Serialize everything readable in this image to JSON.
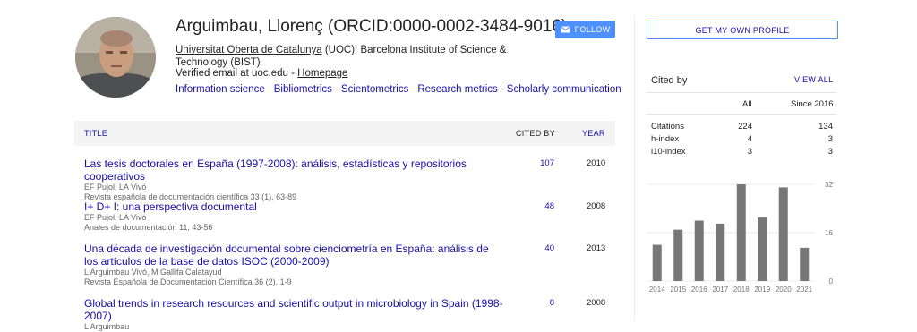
{
  "profile": {
    "name": "Arguimbau, Llorenç (ORCID:0000-0002-3484-9016)",
    "affiliation_link": "Universitat Oberta de Catalunya",
    "affiliation_rest": " (UOC); Barcelona Institute of Science & Technology (BIST)",
    "email_text": "Verified email at uoc.edu - ",
    "homepage_label": "Homepage",
    "interests": [
      "Information science",
      "Bibliometrics",
      "Scientometrics",
      "Research metrics",
      "Scholarly communication"
    ],
    "follow_label": "FOLLOW"
  },
  "sidebar": {
    "own_profile_label": "GET MY OWN PROFILE",
    "cited_by_title": "Cited by",
    "view_all_label": "VIEW ALL",
    "columns": [
      "All",
      "Since 2016"
    ],
    "stats": [
      {
        "label": "Citations",
        "all": "224",
        "since": "134"
      },
      {
        "label": "h-index",
        "all": "4",
        "since": "3"
      },
      {
        "label": "i10-index",
        "all": "3",
        "since": "3"
      }
    ]
  },
  "table": {
    "col_title": "TITLE",
    "col_cited": "CITED BY",
    "col_year": "YEAR",
    "rows": [
      {
        "title": "Las tesis doctorales en España (1997-2008): análisis, estadísticas y repositorios cooperativos",
        "authors": "EF Pujol, LA Vivó",
        "venue": "Revista española de documentación científica 33 (1), 63-89",
        "cited": "107",
        "year": "2010"
      },
      {
        "title": "I+ D+ I: una perspectiva documental",
        "authors": "EF Pujol, LA Vivó",
        "venue": "Anales de documentación 11, 43-56",
        "cited": "48",
        "year": "2008"
      },
      {
        "title": "Una década de investigación documental sobre cienciometría en España: análisis de los artículos de la base de datos ISOC (2000-2009)",
        "authors": "L Arguimbau Vivó, M Gallifa Calatayud",
        "venue": "Revista Española de Documentación Científica 36 (2), 1-9",
        "cited": "40",
        "year": "2013"
      },
      {
        "title": "Global trends in research resources and scientific output in microbiology in Spain (1998-2007)",
        "authors": "L Arguimbau",
        "venue": "",
        "cited": "8",
        "year": "2008"
      }
    ]
  },
  "chart_data": {
    "type": "bar",
    "categories": [
      "2014",
      "2015",
      "2016",
      "2017",
      "2018",
      "2019",
      "2020",
      "2021"
    ],
    "values": [
      12,
      17,
      20,
      19,
      32,
      21,
      31,
      11
    ],
    "ylim": [
      0,
      32
    ],
    "yticks": [
      0,
      16,
      32
    ],
    "bar_color": "#777777",
    "grid": true
  },
  "colors": {
    "link": "#1a0dab",
    "accent_button": "#4d90fe",
    "header_bg": "#f4f4f4"
  },
  "icons": {
    "follow": "envelope-icon"
  }
}
